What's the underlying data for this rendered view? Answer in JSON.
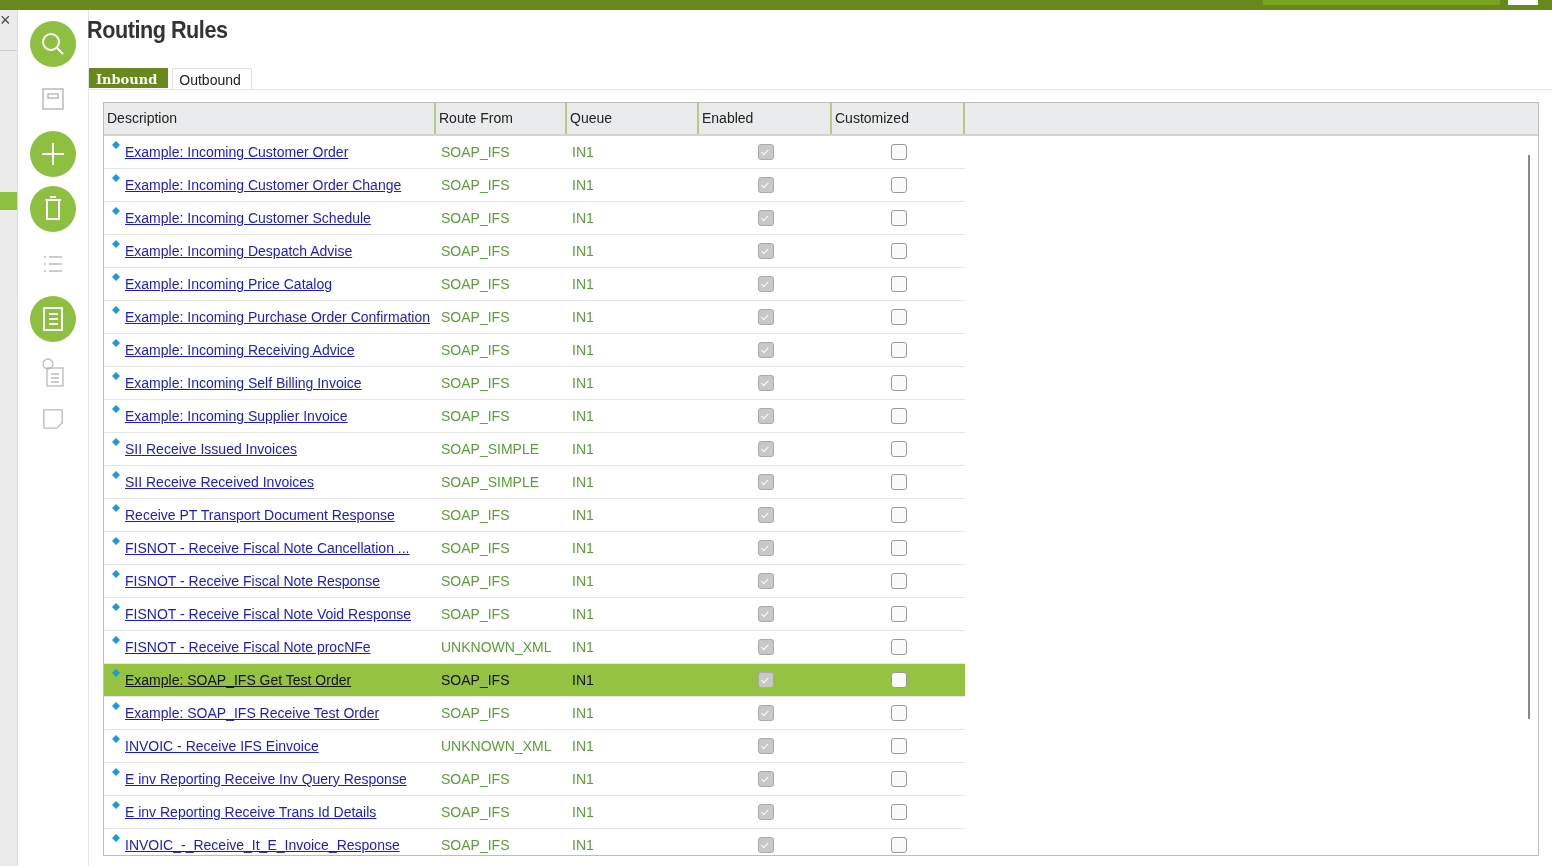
{
  "close_symbol": "×",
  "title": "Routing Rules",
  "tabs": [
    {
      "label": "Inbound",
      "selected": true
    },
    {
      "label": "Outbound",
      "selected": false
    }
  ],
  "columns": [
    "Description",
    "Route From",
    "Queue",
    "Enabled",
    "Customized"
  ],
  "rows": [
    {
      "description": "Example: Incoming Customer Order",
      "route_from": "SOAP_IFS",
      "queue": "IN1",
      "enabled": true,
      "customized": false,
      "selected": false
    },
    {
      "description": "Example: Incoming Customer Order Change",
      "route_from": "SOAP_IFS",
      "queue": "IN1",
      "enabled": true,
      "customized": false,
      "selected": false
    },
    {
      "description": "Example: Incoming Customer Schedule",
      "route_from": "SOAP_IFS",
      "queue": "IN1",
      "enabled": true,
      "customized": false,
      "selected": false
    },
    {
      "description": "Example: Incoming Despatch Advise",
      "route_from": "SOAP_IFS",
      "queue": "IN1",
      "enabled": true,
      "customized": false,
      "selected": false
    },
    {
      "description": "Example: Incoming Price Catalog",
      "route_from": "SOAP_IFS",
      "queue": "IN1",
      "enabled": true,
      "customized": false,
      "selected": false
    },
    {
      "description": "Example: Incoming Purchase Order Confirmation",
      "route_from": "SOAP_IFS",
      "queue": "IN1",
      "enabled": true,
      "customized": false,
      "selected": false
    },
    {
      "description": "Example: Incoming Receiving Advice",
      "route_from": "SOAP_IFS",
      "queue": "IN1",
      "enabled": true,
      "customized": false,
      "selected": false
    },
    {
      "description": "Example: Incoming Self Billing Invoice",
      "route_from": "SOAP_IFS",
      "queue": "IN1",
      "enabled": true,
      "customized": false,
      "selected": false
    },
    {
      "description": "Example: Incoming Supplier Invoice",
      "route_from": "SOAP_IFS",
      "queue": "IN1",
      "enabled": true,
      "customized": false,
      "selected": false
    },
    {
      "description": "SII Receive Issued Invoices",
      "route_from": "SOAP_SIMPLE",
      "queue": "IN1",
      "enabled": true,
      "customized": false,
      "selected": false
    },
    {
      "description": "SII Receive Received Invoices",
      "route_from": "SOAP_SIMPLE",
      "queue": "IN1",
      "enabled": true,
      "customized": false,
      "selected": false
    },
    {
      "description": "Receive PT Transport Document Response",
      "route_from": "SOAP_IFS",
      "queue": "IN1",
      "enabled": true,
      "customized": false,
      "selected": false
    },
    {
      "description": "FISNOT - Receive Fiscal Note Cancellation ...",
      "route_from": "SOAP_IFS",
      "queue": "IN1",
      "enabled": true,
      "customized": false,
      "selected": false
    },
    {
      "description": "FISNOT - Receive Fiscal Note Response",
      "route_from": "SOAP_IFS",
      "queue": "IN1",
      "enabled": true,
      "customized": false,
      "selected": false
    },
    {
      "description": "FISNOT - Receive Fiscal Note Void Response",
      "route_from": "SOAP_IFS",
      "queue": "IN1",
      "enabled": true,
      "customized": false,
      "selected": false
    },
    {
      "description": "FISNOT - Receive Fiscal Note procNFe",
      "route_from": "UNKNOWN_XML",
      "queue": "IN1",
      "enabled": true,
      "customized": false,
      "selected": false
    },
    {
      "description": "Example: SOAP_IFS Get Test Order",
      "route_from": "SOAP_IFS",
      "queue": "IN1",
      "enabled": true,
      "customized": false,
      "selected": true
    },
    {
      "description": "Example: SOAP_IFS Receive Test Order",
      "route_from": "SOAP_IFS",
      "queue": "IN1",
      "enabled": true,
      "customized": false,
      "selected": false
    },
    {
      "description": "INVOIC - Receive IFS Einvoice",
      "route_from": "UNKNOWN_XML",
      "queue": "IN1",
      "enabled": true,
      "customized": false,
      "selected": false
    },
    {
      "description": "E inv Reporting Receive Inv Query Response",
      "route_from": "SOAP_IFS",
      "queue": "IN1",
      "enabled": true,
      "customized": false,
      "selected": false
    },
    {
      "description": "E inv Reporting Receive Trans Id Details",
      "route_from": "SOAP_IFS",
      "queue": "IN1",
      "enabled": true,
      "customized": false,
      "selected": false
    },
    {
      "description": "INVOIC_-_Receive_It_E_Invoice_Response",
      "route_from": "SOAP_IFS",
      "queue": "IN1",
      "enabled": true,
      "customized": false,
      "selected": false
    }
  ]
}
